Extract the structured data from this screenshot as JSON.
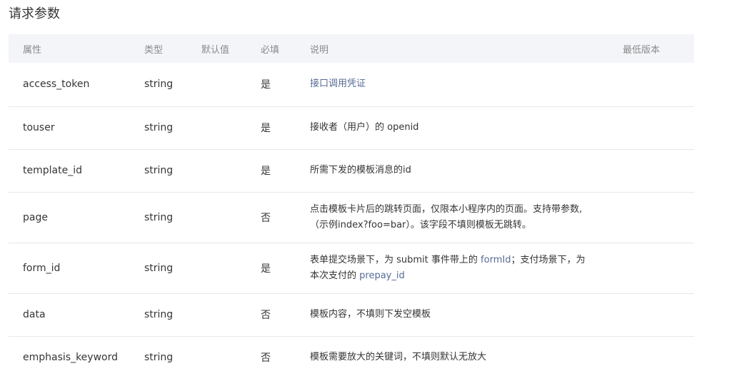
{
  "title": "请求参数",
  "headers": {
    "name": "属性",
    "type": "类型",
    "default": "默认值",
    "required": "必填",
    "desc": "说明",
    "version": "最低版本"
  },
  "rows": [
    {
      "name": "access_token",
      "type": "string",
      "required": "是",
      "desc_link": "接口调用凭证"
    },
    {
      "name": "touser",
      "type": "string",
      "required": "是",
      "desc": "接收者（用户）的 openid"
    },
    {
      "name": "template_id",
      "type": "string",
      "required": "是",
      "desc": "所需下发的模板消息的id"
    },
    {
      "name": "page",
      "type": "string",
      "required": "否",
      "desc_line1": "点击模板卡片后的跳转页面，仅限本小程序内的页面。支持带参数,",
      "desc_line2": "（示例index?foo=bar）。该字段不填则模板无跳转。"
    },
    {
      "name": "form_id",
      "type": "string",
      "required": "是",
      "desc_a": "表单提交场景下，为 submit 事件带上的 ",
      "desc_link_a": "formId",
      "desc_b": "；支付场景下，为",
      "desc_c": "本次支付的 ",
      "desc_link_b": "prepay_id"
    },
    {
      "name": "data",
      "type": "string",
      "required": "否",
      "desc": "模板内容，不填则下发空模板"
    },
    {
      "name": "emphasis_keyword",
      "type": "string",
      "required": "否",
      "desc": "模板需要放大的关键词，不填则默认无放大"
    }
  ]
}
